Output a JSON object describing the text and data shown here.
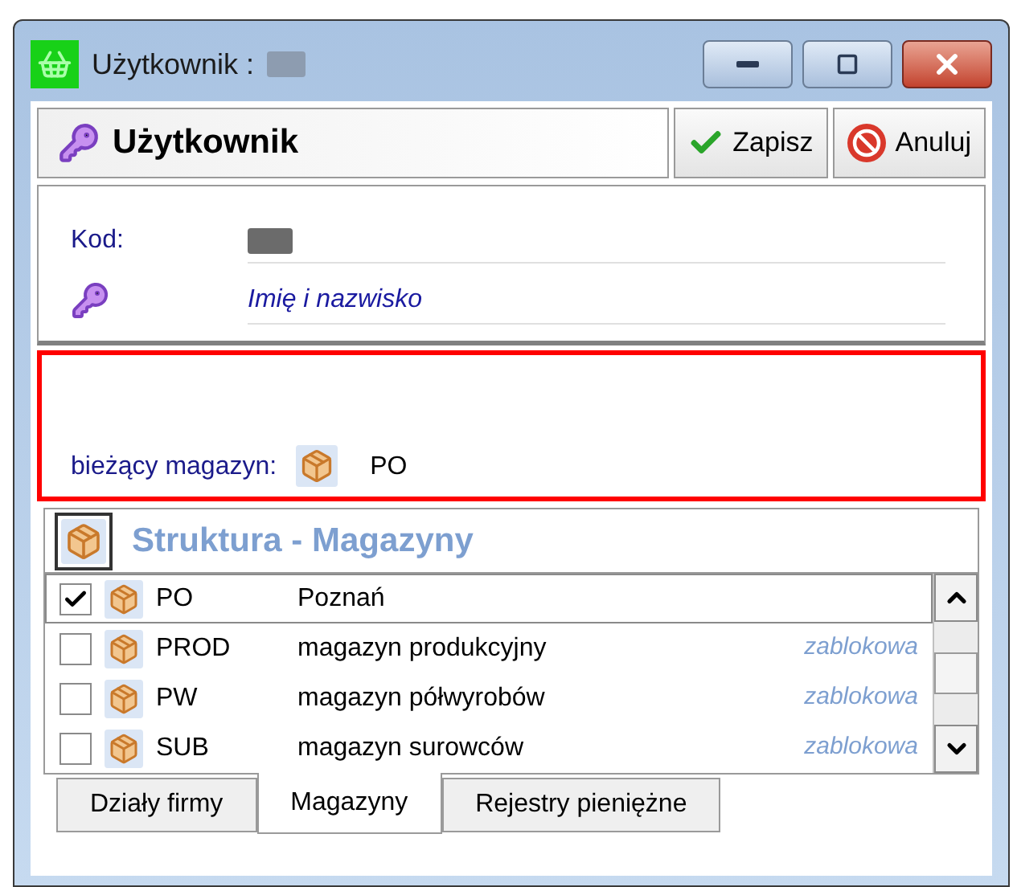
{
  "window": {
    "title": "Użytkownik :"
  },
  "header": {
    "title": "Użytkownik",
    "buttons": [
      {
        "label": "Zapisz",
        "kind": "save"
      },
      {
        "label": "Anuluj",
        "kind": "cancel"
      }
    ]
  },
  "form": {
    "code_label": "Kod:",
    "name_placeholder": "Imię i nazwisko"
  },
  "current_warehouse": {
    "label": "bieżący magazyn:",
    "value": "PO"
  },
  "structure": {
    "title": "Struktura - Magazyny",
    "rows": [
      {
        "code": "PO",
        "name": "Poznań",
        "checked": true,
        "selected": true
      },
      {
        "code": "PROD",
        "name": "magazyn produkcyjny",
        "status": "zablokowa",
        "checked": false,
        "selected": false
      },
      {
        "code": "PW",
        "name": "magazyn półwyrobów",
        "status": "zablokowa",
        "checked": false,
        "selected": false
      },
      {
        "code": "SUB",
        "name": "magazyn surowców",
        "status": "zablokowa",
        "checked": false,
        "selected": false
      }
    ]
  },
  "tabs": [
    {
      "label": "Działy firmy",
      "selected": false
    },
    {
      "label": "Magazyny",
      "selected": true
    },
    {
      "label": "Rejestry pieniężne",
      "selected": false
    }
  ]
}
